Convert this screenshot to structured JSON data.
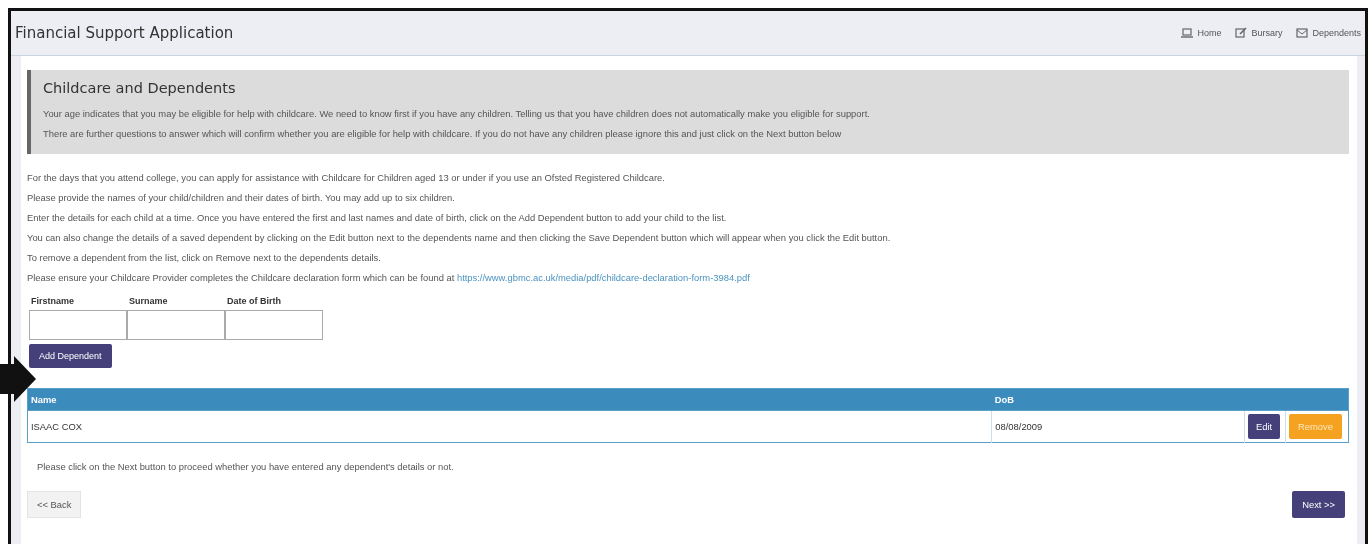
{
  "header": {
    "title": "Financial Support Application",
    "breadcrumbs": [
      {
        "label": "Home"
      },
      {
        "label": "Bursary"
      },
      {
        "label": "Dependents"
      }
    ]
  },
  "notice": {
    "title": "Childcare and Dependents",
    "lines": [
      "Your age indicates that you may be eligible for help with childcare. We need to know first if you have any children. Telling us that you have children does not automatically make you eligible for support.",
      "There are further questions to answer which will confirm whether you are eligible for help with childcare. If you do not have any children please ignore this and just click on the Next button below"
    ]
  },
  "instructions": [
    "For the days that you attend college, you can apply for assistance with Childcare for Children aged 13 or under if you use an Ofsted Registered Childcare.",
    "Please provide the names of your child/children and their dates of birth. You may add up to six children.",
    "Enter the details for each child at a time. Once you have entered the first and last names and date of birth, click on the Add Dependent button to add your child to the list.",
    "You can also change the details of a saved dependent by clicking on the Edit button next to the dependents name and then clicking the Save Dependent button which will appear when you click the Edit button.",
    "To remove a dependent from the list, click on Remove next to the dependents details."
  ],
  "declaration": {
    "text": "Please ensure your Childcare Provider completes the Childcare declaration form which can be found at",
    "link": "https://www.gbmc.ac.uk/media/pdf/childcare-declaration-form-3984.pdf"
  },
  "form": {
    "fields": [
      {
        "label": "Firstname"
      },
      {
        "label": "Surname"
      },
      {
        "label": "Date of Birth"
      }
    ],
    "add_button": "Add Dependent"
  },
  "table": {
    "columns": [
      "Name",
      "DoB"
    ],
    "rows": [
      {
        "name": "ISAAC COX",
        "dob": "08/08/2009",
        "edit": "Edit",
        "remove": "Remove"
      }
    ]
  },
  "footer_note": "Please click on the Next button to proceed whether you have entered any dependent's details or not.",
  "back_button": "<< Back",
  "next_button": "Next >>"
}
